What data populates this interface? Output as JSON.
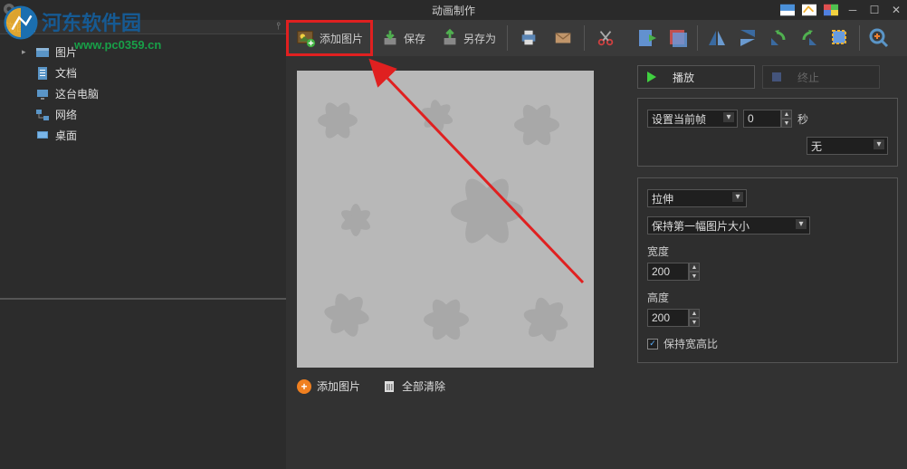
{
  "title": "动画制作",
  "watermark": {
    "brand": "河东软件园",
    "url": "www.pc0359.cn"
  },
  "sidebar": {
    "header": "浏图片",
    "items": [
      {
        "label": "图片",
        "expandable": true
      },
      {
        "label": "文档",
        "expandable": false
      },
      {
        "label": "这台电脑",
        "expandable": false
      },
      {
        "label": "网络",
        "expandable": false
      },
      {
        "label": "桌面",
        "expandable": false
      }
    ]
  },
  "toolbar": {
    "add_image": "添加图片",
    "save": "保存",
    "save_as": "另存为"
  },
  "bottom_actions": {
    "add_image": "添加图片",
    "clear_all": "全部清除"
  },
  "controls": {
    "play": "播放",
    "stop": "终止"
  },
  "frame_panel": {
    "set_current_frame": "设置当前帧",
    "frame_value": "0",
    "seconds_label": "秒",
    "repeat_value": "无"
  },
  "size_panel": {
    "scale_mode": "拉伸",
    "keep_size_mode": "保持第一幅图片大小",
    "width_label": "宽度",
    "width_value": "200",
    "height_label": "高度",
    "height_value": "200",
    "keep_ratio": "保持宽高比"
  }
}
